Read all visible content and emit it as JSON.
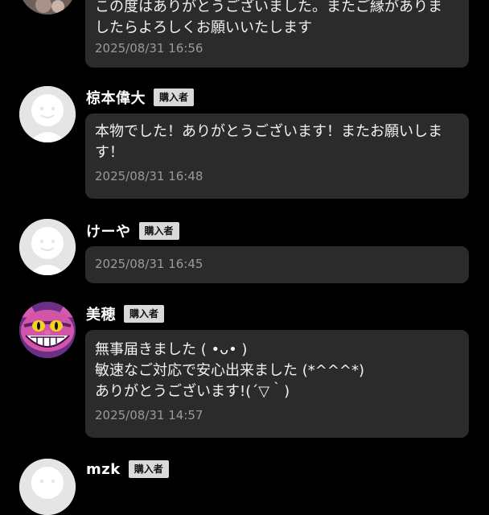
{
  "reviews": [
    {
      "name": "",
      "badge": "",
      "message": "この度はありがとうございました。またご縁がありましたらよろしくお願いいたします",
      "time": "2025/08/31 16:56"
    },
    {
      "name": "椋本偉大",
      "badge": "購入者",
      "message": "本物でした！ありがとうございます！またお願いします！",
      "time": "2025/08/31 16:48"
    },
    {
      "name": "けーや",
      "badge": "購入者",
      "message": "",
      "time": "2025/08/31 16:45"
    },
    {
      "name": "美穂",
      "badge": "購入者",
      "message": "無事届きました ( •ᴗ• )\n敏速なご対応で安心出来ました (*^^^*)\nありがとうございます!(´▽｀)",
      "time": "2025/08/31 14:57"
    },
    {
      "name": "mzk",
      "badge": "購入者",
      "message": "",
      "time": ""
    }
  ]
}
